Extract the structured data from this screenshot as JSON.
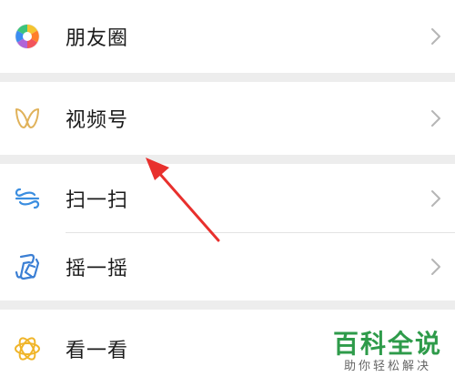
{
  "menu": {
    "items": [
      {
        "label": "朋友圈",
        "icon": "moments-icon"
      },
      {
        "label": "视频号",
        "icon": "channels-icon"
      },
      {
        "label": "扫一扫",
        "icon": "scan-icon"
      },
      {
        "label": "摇一摇",
        "icon": "shake-icon"
      },
      {
        "label": "看一看",
        "icon": "top-stories-icon"
      }
    ]
  },
  "watermark": {
    "title": "百科全说",
    "subtitle": "助你轻松解决"
  },
  "colors": {
    "accent_arrow": "#e8302d",
    "watermark": "#2e9b4a",
    "background": "#ededed"
  }
}
